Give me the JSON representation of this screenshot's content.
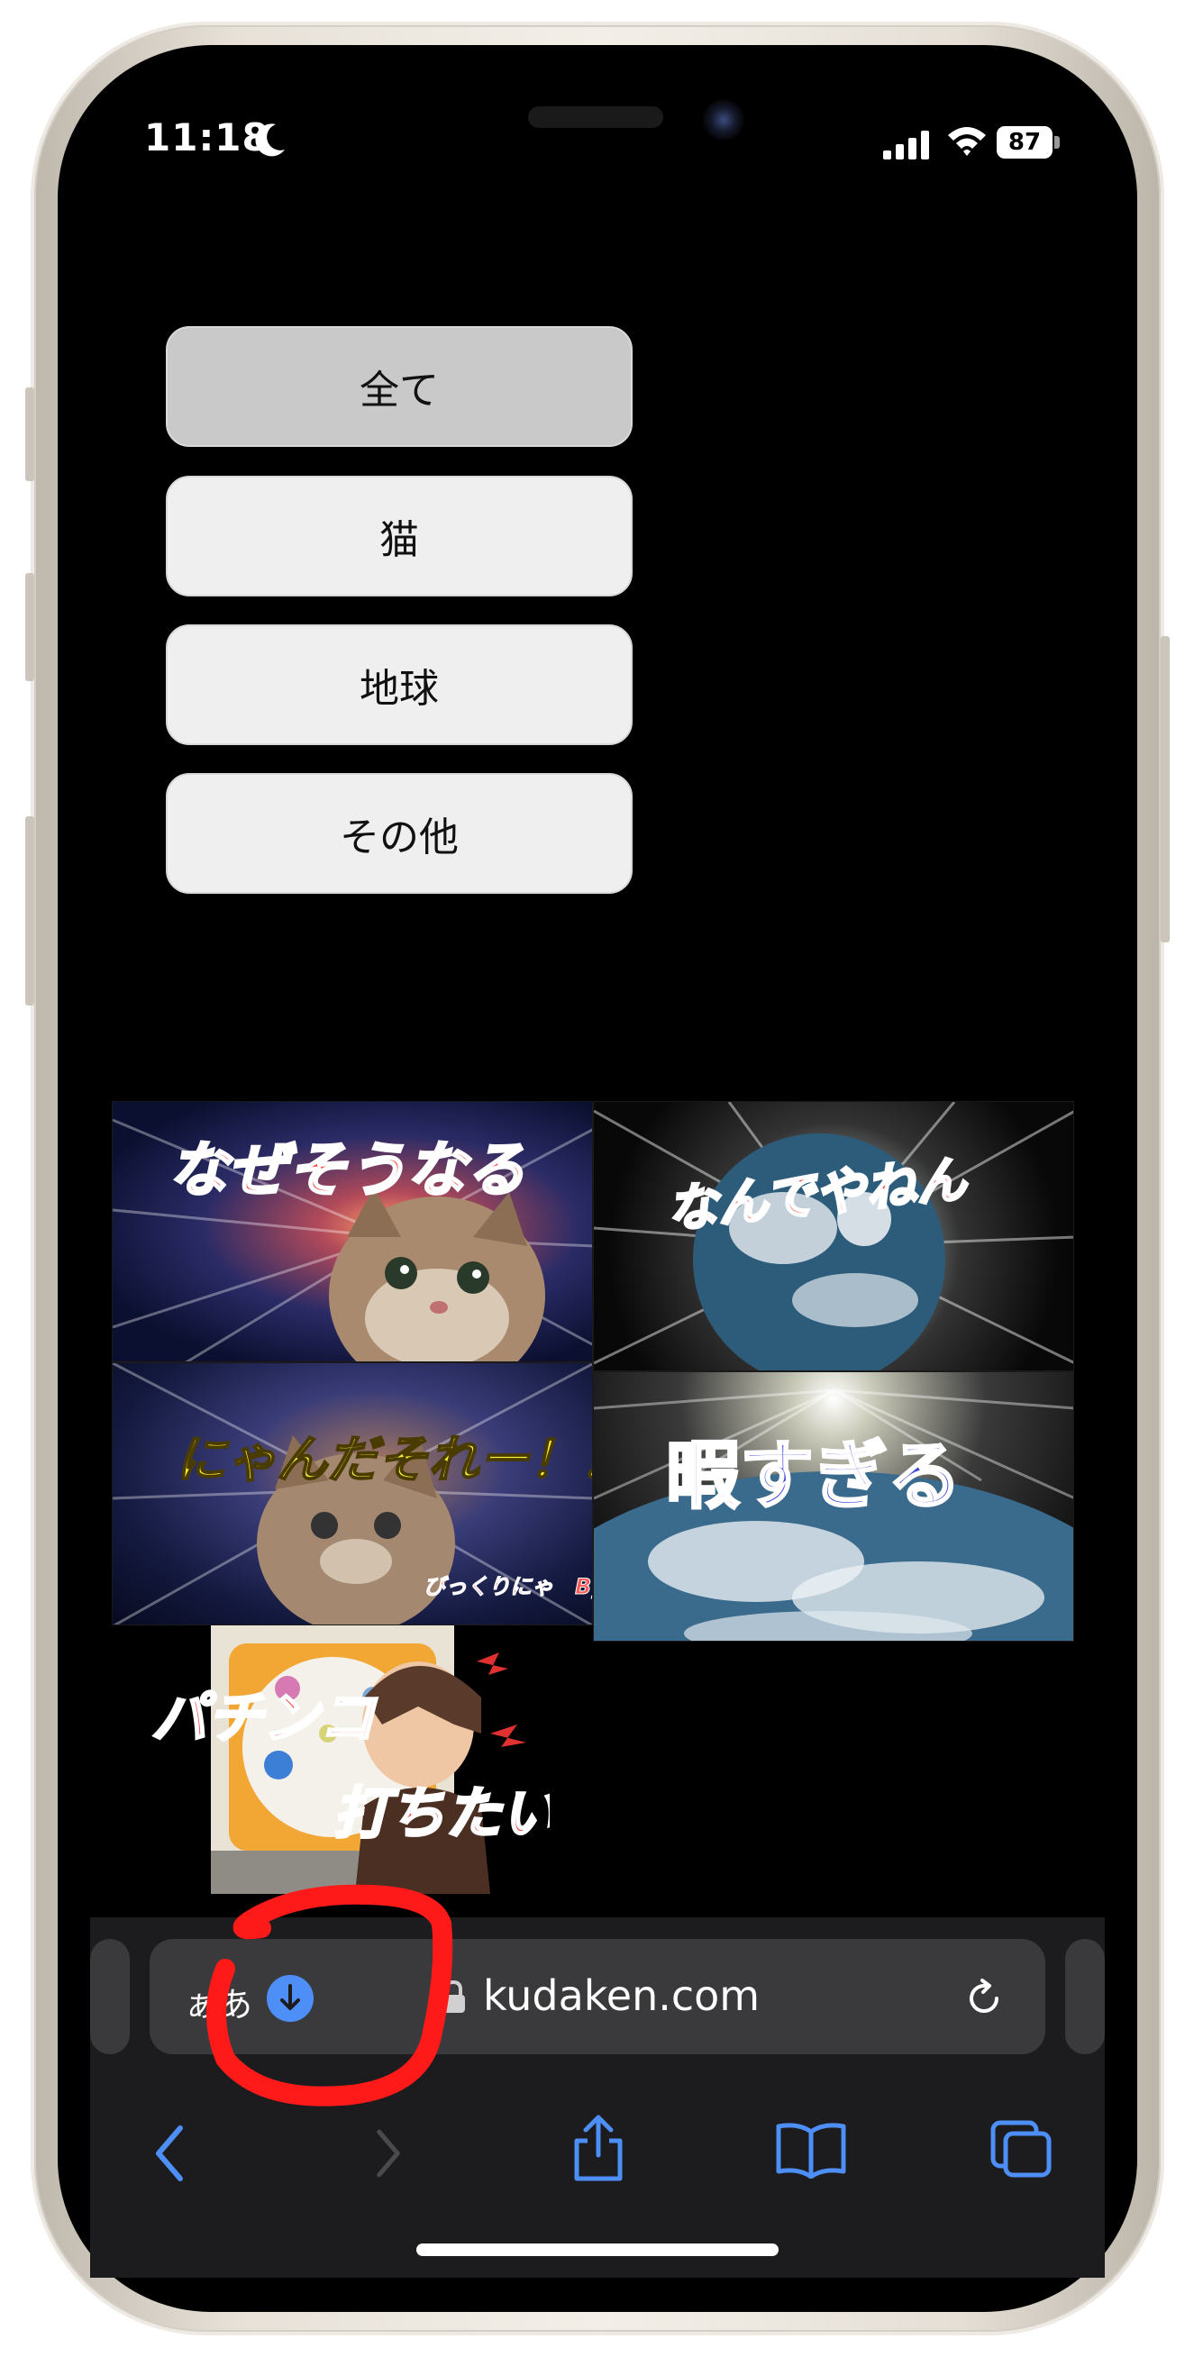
{
  "status_bar": {
    "time": "11:18",
    "battery": "87"
  },
  "filters": [
    {
      "label": "全て",
      "active": true
    },
    {
      "label": "猫",
      "active": false
    },
    {
      "label": "地球",
      "active": false
    },
    {
      "label": "その他",
      "active": false
    }
  ],
  "thumbnails": [
    {
      "caption": "なぜそうなる",
      "category": "猫"
    },
    {
      "caption": "なんでやねん",
      "category": "地球"
    },
    {
      "caption": "にゃんだそれー！！",
      "subcaption": "びっくりにゃ　By猫",
      "category": "猫"
    },
    {
      "caption": "暇すぎる",
      "category": "地球"
    },
    {
      "caption_line1": "パチンコ",
      "caption_line2": "打ちたい",
      "category": "その他"
    }
  ],
  "browser": {
    "aa_label": "ぁあ",
    "url": "kudaken.com"
  },
  "toolbar_icons": [
    "back-icon",
    "forward-icon",
    "share-icon",
    "bookmarks-icon",
    "tabs-icon"
  ],
  "colors": {
    "accent": "#4d8ef7",
    "annotation": "#ff1a1a",
    "button_active": "#c9c9c9",
    "button": "#efefef"
  }
}
